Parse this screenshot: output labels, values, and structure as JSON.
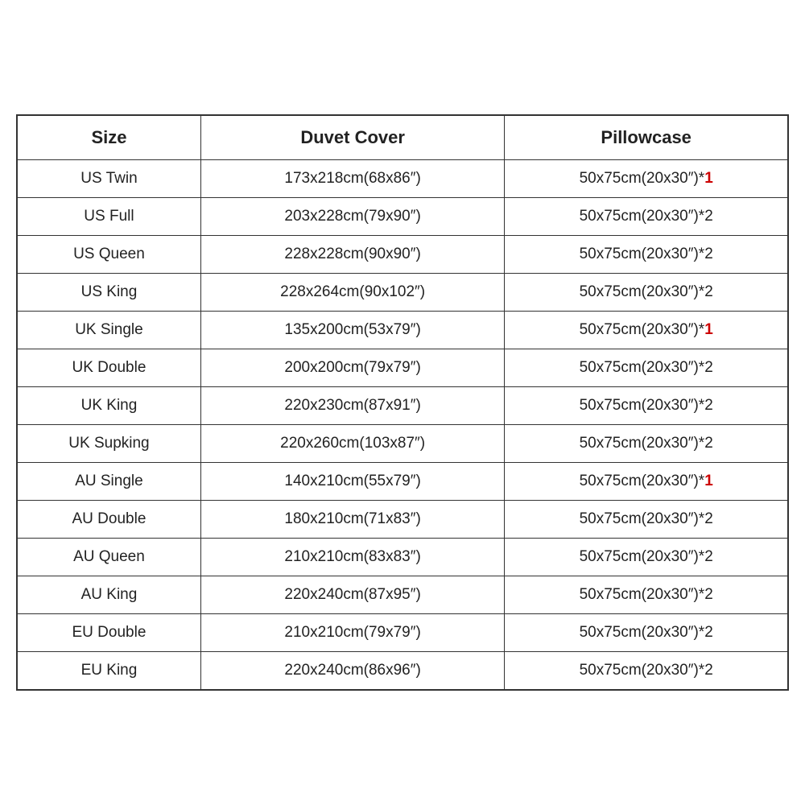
{
  "table": {
    "headers": [
      "Size",
      "Duvet Cover",
      "Pillowcase"
    ],
    "rows": [
      {
        "size": "US Twin",
        "duvet": "173x218cm(68x86″)",
        "pillowcase_base": "50x75cm(20x30″)*",
        "pillowcase_count": "1",
        "is_red": true
      },
      {
        "size": "US Full",
        "duvet": "203x228cm(79x90″)",
        "pillowcase_base": "50x75cm(20x30″)*",
        "pillowcase_count": "2",
        "is_red": false
      },
      {
        "size": "US Queen",
        "duvet": "228x228cm(90x90″)",
        "pillowcase_base": "50x75cm(20x30″)*",
        "pillowcase_count": "2",
        "is_red": false
      },
      {
        "size": "US King",
        "duvet": "228x264cm(90x102″)",
        "pillowcase_base": "50x75cm(20x30″)*",
        "pillowcase_count": "2",
        "is_red": false
      },
      {
        "size": "UK Single",
        "duvet": "135x200cm(53x79″)",
        "pillowcase_base": "50x75cm(20x30″)*",
        "pillowcase_count": "1",
        "is_red": true
      },
      {
        "size": "UK Double",
        "duvet": "200x200cm(79x79″)",
        "pillowcase_base": "50x75cm(20x30″)*",
        "pillowcase_count": "2",
        "is_red": false
      },
      {
        "size": "UK King",
        "duvet": "220x230cm(87x91″)",
        "pillowcase_base": "50x75cm(20x30″)*",
        "pillowcase_count": "2",
        "is_red": false
      },
      {
        "size": "UK Supking",
        "duvet": "220x260cm(103x87″)",
        "pillowcase_base": "50x75cm(20x30″)*",
        "pillowcase_count": "2",
        "is_red": false
      },
      {
        "size": "AU Single",
        "duvet": "140x210cm(55x79″)",
        "pillowcase_base": "50x75cm(20x30″)*",
        "pillowcase_count": "1",
        "is_red": true
      },
      {
        "size": "AU Double",
        "duvet": "180x210cm(71x83″)",
        "pillowcase_base": "50x75cm(20x30″)*",
        "pillowcase_count": "2",
        "is_red": false
      },
      {
        "size": "AU Queen",
        "duvet": "210x210cm(83x83″)",
        "pillowcase_base": "50x75cm(20x30″)*",
        "pillowcase_count": "2",
        "is_red": false
      },
      {
        "size": "AU King",
        "duvet": "220x240cm(87x95″)",
        "pillowcase_base": "50x75cm(20x30″)*",
        "pillowcase_count": "2",
        "is_red": false
      },
      {
        "size": "EU Double",
        "duvet": "210x210cm(79x79″)",
        "pillowcase_base": "50x75cm(20x30″)*",
        "pillowcase_count": "2",
        "is_red": false
      },
      {
        "size": "EU King",
        "duvet": "220x240cm(86x96″)",
        "pillowcase_base": "50x75cm(20x30″)*",
        "pillowcase_count": "2",
        "is_red": false
      }
    ]
  }
}
